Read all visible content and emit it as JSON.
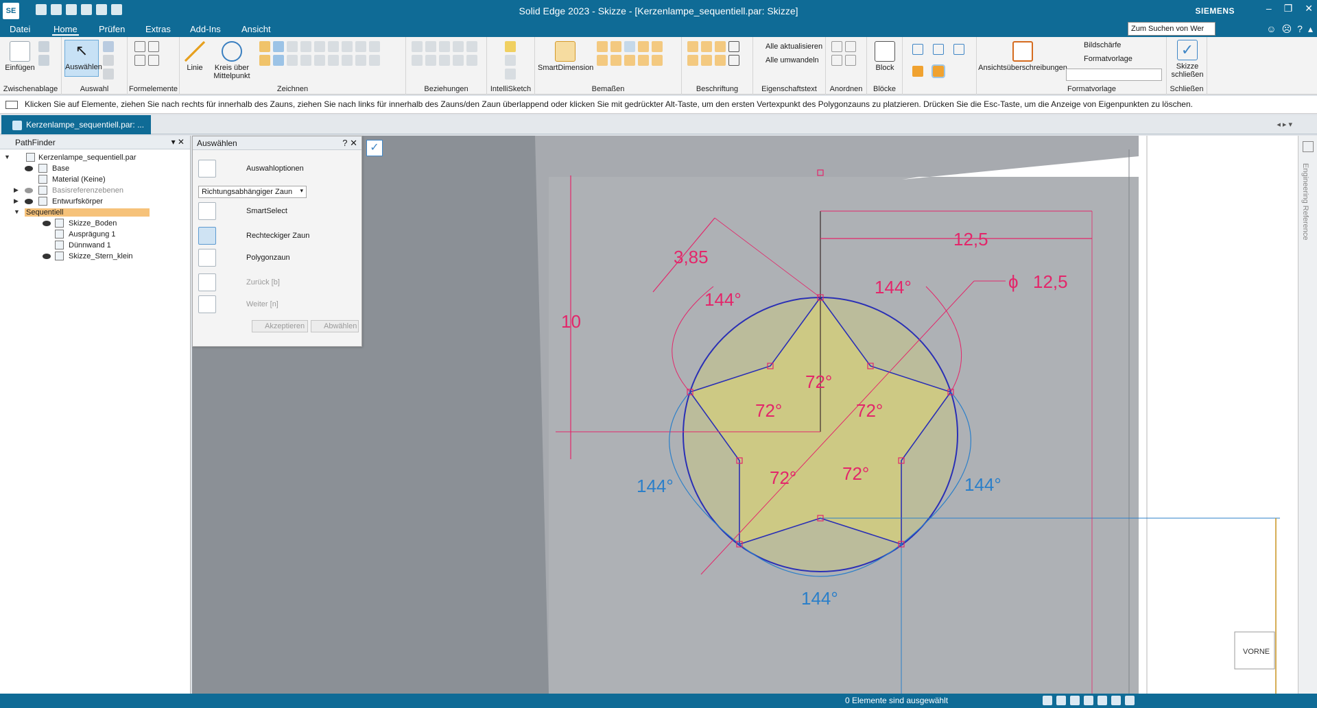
{
  "window": {
    "app_icon": "SE",
    "title": "Solid Edge 2023 - Skizze - [Kerzenlampe_sequentiell.par: Skizze]",
    "brand": "SIEMENS"
  },
  "menu": {
    "tabs": [
      "Datei",
      "Home",
      "Prüfen",
      "Extras",
      "Add-Ins",
      "Ansicht"
    ],
    "active_tab": "Home",
    "search_placeholder": "Zum Suchen von Wer"
  },
  "ribbon": {
    "groups": {
      "zwischenablage": "Zwischenablage",
      "auswahl": "Auswahl",
      "formelemente": "Formelemente",
      "zeichnen": "Zeichnen",
      "beziehungen": "Beziehungen",
      "intellisketch": "IntelliSketch",
      "bemassen": "Bemaßen",
      "beschriftung": "Beschriftung",
      "eigenschaftstext": "Eigenschaftstext",
      "anordnen": "Anordnen",
      "bloecke": "Blöcke",
      "formatvorlage": "Formatvorlage",
      "schliessen": "Schließen"
    },
    "buttons": {
      "einfuegen": "Einfügen",
      "auswaehlen": "Auswählen",
      "linie": "Linie",
      "kreis1": "Kreis über",
      "kreis2": "Mittelpunkt",
      "smartdimension": "SmartDimension",
      "alle_aktualisieren": "Alle aktualisieren",
      "alle_umwandeln": "Alle umwandeln",
      "block": "Block",
      "ansichtsueberschreibungen": "Ansichtsüberschreibungen",
      "bildschaerfe": "Bildschärfe",
      "formatvorlage": "Formatvorlage",
      "skizze1": "Skizze",
      "skizze2": "schließen"
    }
  },
  "prompt": "Klicken Sie auf Elemente, ziehen Sie nach rechts für innerhalb des Zauns, ziehen Sie nach links für innerhalb des Zauns/den Zaun überlappend oder klicken Sie mit gedrückter Alt-Taste, um den ersten Vertexpunkt des Polygonzauns zu platzieren. Drücken Sie die Esc-Taste, um die Anzeige von Eigenpunkten zu löschen.",
  "document_tab": "Kerzenlampe_sequentiell.par: ...",
  "pathfinder": {
    "title": "PathFinder",
    "items": [
      {
        "label": "Kerzenlampe_sequentiell.par"
      },
      {
        "label": "Base"
      },
      {
        "label": "Material (Keine)"
      },
      {
        "label": "Basisreferenzebenen"
      },
      {
        "label": "Entwurfskörper"
      },
      {
        "label": "Sequentiell"
      },
      {
        "label": "Skizze_Boden"
      },
      {
        "label": "Ausprägung 1"
      },
      {
        "label": "Dünnwand 1"
      },
      {
        "label": "Skizze_Stern_klein"
      }
    ]
  },
  "select_panel": {
    "title": "Auswählen",
    "help": "?",
    "options_label": "Auswahloptionen",
    "fence_mode": "Richtungsabhängiger Zaun",
    "smartselect": "SmartSelect",
    "rect_fence": "Rechteckiger Zaun",
    "polygon_fence": "Polygonzaun",
    "back": "Zurück [b]",
    "next": "Weiter [n]",
    "accept": "Akzeptieren",
    "deselect": "Abwählen"
  },
  "sketch": {
    "dim_width": "12,5",
    "dim_diameter": "12,5",
    "diameter_symbol": "ϕ",
    "dim_offset": "3,85",
    "dim_height": "10",
    "angle_144": "144°",
    "angle_72": "72°",
    "view_cube": "VORNE"
  },
  "rightbar_label": "Engineering Reference",
  "status": "0 Elemente sind ausgewählt"
}
